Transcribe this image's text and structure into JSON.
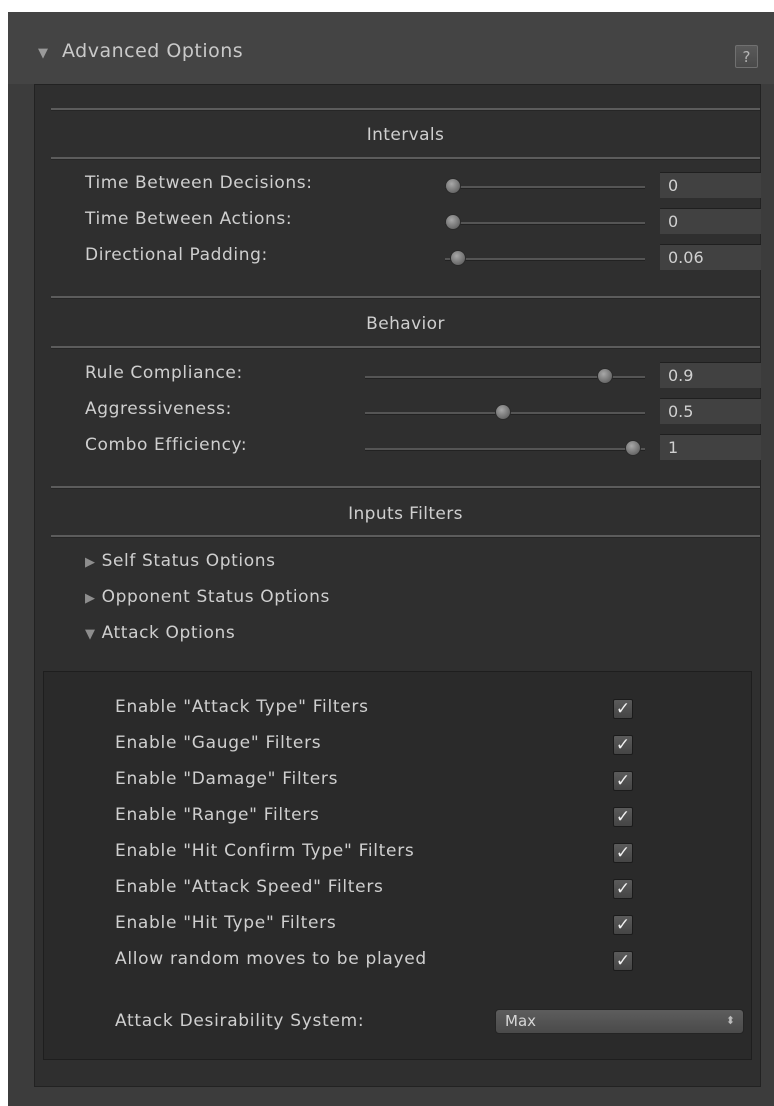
{
  "panel": {
    "title": "Advanced Options",
    "help_label": "?",
    "expand_icon": "triangle-down-icon"
  },
  "intervals": {
    "title": "Intervals",
    "rows": [
      {
        "label": "Time Between Decisions:",
        "value": "0",
        "fraction": 0.0
      },
      {
        "label": "Time Between Actions:",
        "value": "0",
        "fraction": 0.0
      },
      {
        "label": "Directional Padding:",
        "value": "0.06",
        "fraction": 0.06
      }
    ]
  },
  "behavior": {
    "title": "Behavior",
    "rows": [
      {
        "label": "Rule Compliance:",
        "value": "0.9",
        "fraction": 0.9
      },
      {
        "label": "Aggressiveness:",
        "value": "0.5",
        "fraction": 0.5
      },
      {
        "label": "Combo Efficiency:",
        "value": "1",
        "fraction": 1.0
      }
    ]
  },
  "filters": {
    "title": "Inputs Filters",
    "foldouts": [
      {
        "label": "Self Status Options",
        "expanded": false
      },
      {
        "label": "Opponent Status Options",
        "expanded": false
      },
      {
        "label": "Attack Options",
        "expanded": true
      }
    ]
  },
  "attack_options": {
    "checkboxes": [
      {
        "label": "Enable \"Attack Type\" Filters",
        "checked": true
      },
      {
        "label": "Enable \"Gauge\" Filters",
        "checked": true
      },
      {
        "label": "Enable \"Damage\" Filters",
        "checked": true
      },
      {
        "label": "Enable \"Range\" Filters",
        "checked": true
      },
      {
        "label": "Enable \"Hit Confirm Type\" Filters",
        "checked": true
      },
      {
        "label": "Enable \"Attack Speed\" Filters",
        "checked": true
      },
      {
        "label": "Enable \"Hit Type\" Filters",
        "checked": true
      },
      {
        "label": "Allow random moves to be played",
        "checked": true
      }
    ],
    "desirability_label": "Attack Desirability System:",
    "desirability_value": "Max"
  },
  "colors": {
    "panel_bg": "#3c3c3c",
    "inner_bg": "#2f2f2f",
    "text": "#cfcfcf"
  }
}
